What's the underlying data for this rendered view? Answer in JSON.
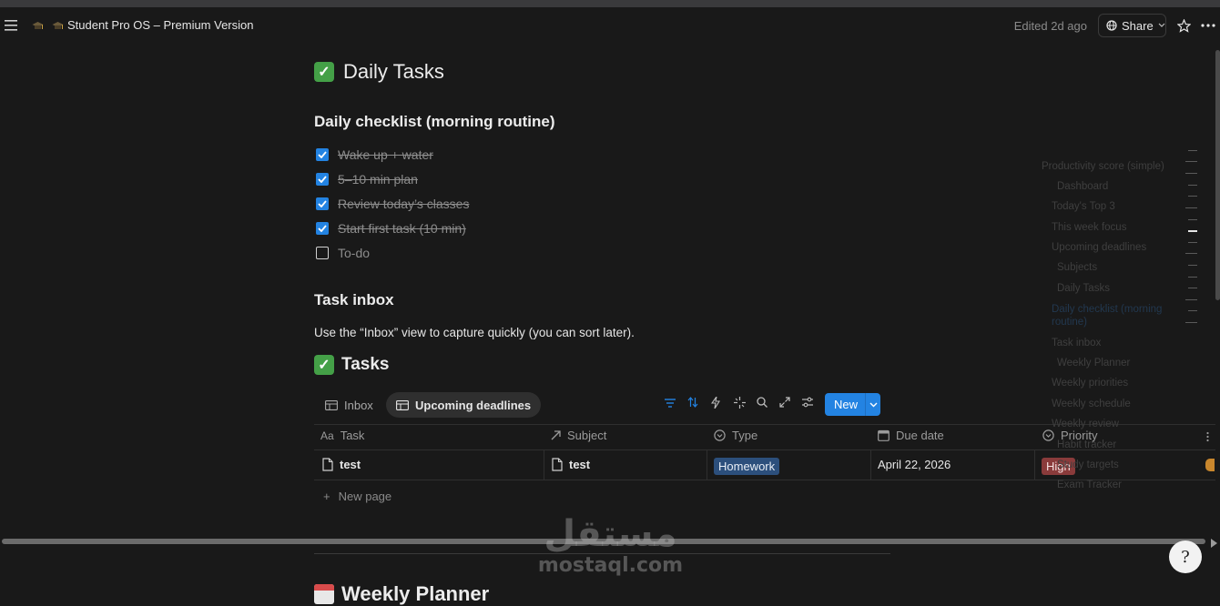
{
  "topbar": {
    "breadcrumb_parent_icon": "graduation-cap-icon",
    "breadcrumb_icon": "graduation-cap-icon",
    "breadcrumb_title": "Student Pro OS – Premium Version",
    "edited_text": "Edited 2d ago",
    "share_label": "Share"
  },
  "page": {
    "title": "Daily Tasks",
    "title_icon": "white-check-mark-emoji"
  },
  "checklist": {
    "heading": "Daily checklist (morning routine)",
    "items": [
      {
        "label": "Wake up + water",
        "checked": true
      },
      {
        "label": "5–10 min plan",
        "checked": true
      },
      {
        "label": "Review today’s classes",
        "checked": true
      },
      {
        "label": "Start first task (10 min)",
        "checked": true
      },
      {
        "label": "To-do",
        "checked": false
      }
    ]
  },
  "inbox_section": {
    "heading": "Task inbox",
    "text": "Use the “Inbox” view to capture quickly (you can sort later)."
  },
  "database": {
    "title": "Tasks",
    "views": [
      {
        "label": "Inbox",
        "active": false
      },
      {
        "label": "Upcoming deadlines",
        "active": true
      }
    ],
    "new_button_label": "New",
    "columns": [
      {
        "label": "Task",
        "icon": "title-aa-icon"
      },
      {
        "label": "Subject",
        "icon": "relation-arrow-icon"
      },
      {
        "label": "Type",
        "icon": "select-icon"
      },
      {
        "label": "Due date",
        "icon": "calendar-icon"
      },
      {
        "label": "Priority",
        "icon": "select-icon"
      }
    ],
    "rows": [
      {
        "task": "test",
        "subject": "test",
        "type": "Homework",
        "due_date": "April 22, 2026",
        "priority": "High"
      }
    ],
    "new_page_label": "New page",
    "tag_colors": {
      "Homework": "#2c4f7c",
      "High": "#8a3b3b"
    }
  },
  "next_section": {
    "title": "Weekly Planner"
  },
  "outline": [
    "Productivity score (simple)",
    "Dashboard",
    "Today's Top 3",
    "This week focus",
    "Upcoming deadlines",
    "Subjects",
    "Daily Tasks",
    "Daily checklist (morning routine)",
    "Task inbox",
    "Weekly Planner",
    "Weekly priorities",
    "Weekly schedule",
    "Weekly review",
    "Habit tracker",
    "Study targets",
    "Exam Tracker"
  ],
  "watermark": {
    "arabic": "مستقل",
    "latin": "mostaql.com"
  },
  "help_button_label": "?"
}
